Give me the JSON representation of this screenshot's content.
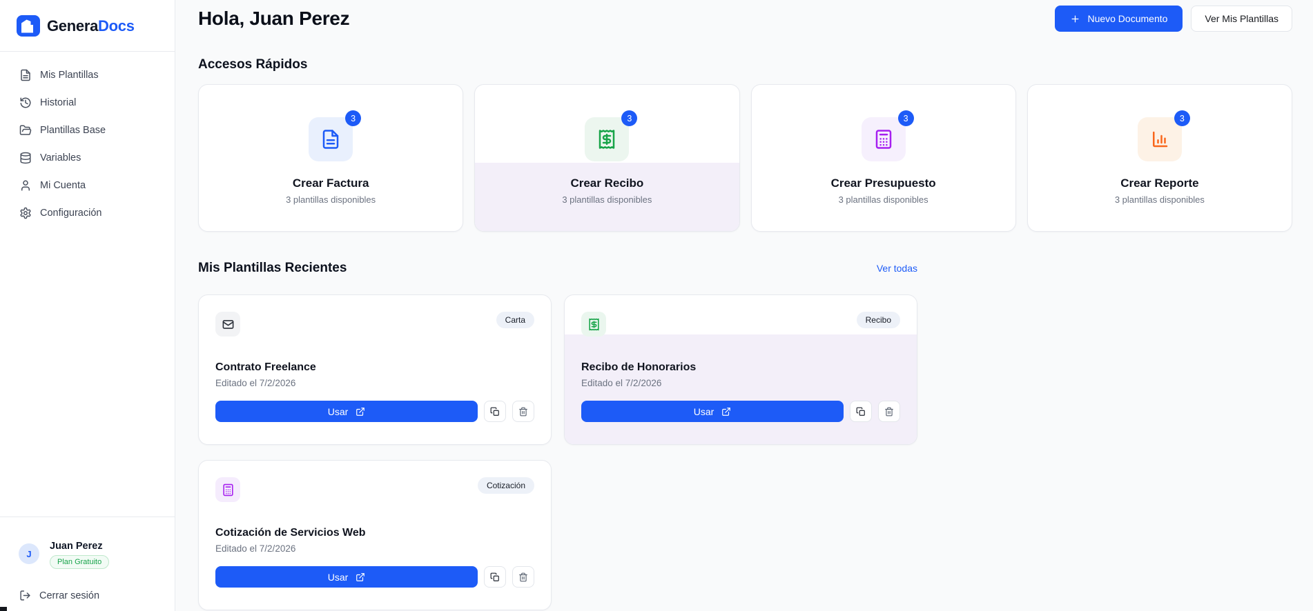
{
  "brand": {
    "name_primary": "Genera",
    "name_secondary": "Docs"
  },
  "colors": {
    "primary_blue": "#1d5bf7",
    "accent_green": "#18a449",
    "accent_purple": "#a620f0",
    "accent_orange": "#f9671c",
    "plan_badge_green": "#17a34a",
    "highlight_lavender": "#f3eff9"
  },
  "sidebar": {
    "items": [
      {
        "label": "Mis Plantillas",
        "icon": "file-text-icon"
      },
      {
        "label": "Historial",
        "icon": "history-icon"
      },
      {
        "label": "Plantillas Base",
        "icon": "folder-open-icon"
      },
      {
        "label": "Variables",
        "icon": "database-icon"
      },
      {
        "label": "Mi Cuenta",
        "icon": "user-icon"
      },
      {
        "label": "Configuración",
        "icon": "gear-icon"
      }
    ],
    "user": {
      "initial": "J",
      "name": "Juan Perez",
      "plan_badge": "Plan Gratuito"
    },
    "logout_label": "Cerrar sesión"
  },
  "header": {
    "greeting": "Hola, Juan Perez",
    "new_document_label": "Nuevo Documento",
    "view_templates_label": "Ver Mis Plantillas"
  },
  "quick_access": {
    "title": "Accesos Rápidos",
    "cards": [
      {
        "title": "Crear Factura",
        "subtitle": "3 plantillas disponibles",
        "count": "3",
        "icon": "invoice-icon",
        "accent": "#1d5bf7",
        "highlighted": false
      },
      {
        "title": "Crear Recibo",
        "subtitle": "3 plantillas disponibles",
        "count": "3",
        "icon": "receipt-icon",
        "accent": "#18a449",
        "highlighted": true
      },
      {
        "title": "Crear Presupuesto",
        "subtitle": "3 plantillas disponibles",
        "count": "3",
        "icon": "calculator-icon",
        "accent": "#a620f0",
        "highlighted": false
      },
      {
        "title": "Crear Reporte",
        "subtitle": "3 plantillas disponibles",
        "count": "3",
        "icon": "bar-chart-icon",
        "accent": "#f9671c",
        "highlighted": false
      }
    ]
  },
  "recent": {
    "title": "Mis Plantillas Recientes",
    "view_all_label": "Ver todas",
    "use_label": "Usar",
    "cards": [
      {
        "title": "Contrato Freelance",
        "edited": "Editado el 7/2/2026",
        "badge": "Carta",
        "icon": "envelope-icon",
        "highlighted": false
      },
      {
        "title": "Recibo de Honorarios",
        "edited": "Editado el 7/2/2026",
        "badge": "Recibo",
        "icon": "receipt-icon",
        "highlighted": true
      },
      {
        "title": "Cotización de Servicios Web",
        "edited": "Editado el 7/2/2026",
        "badge": "Cotización",
        "icon": "calculator-icon",
        "highlighted": false
      }
    ]
  }
}
